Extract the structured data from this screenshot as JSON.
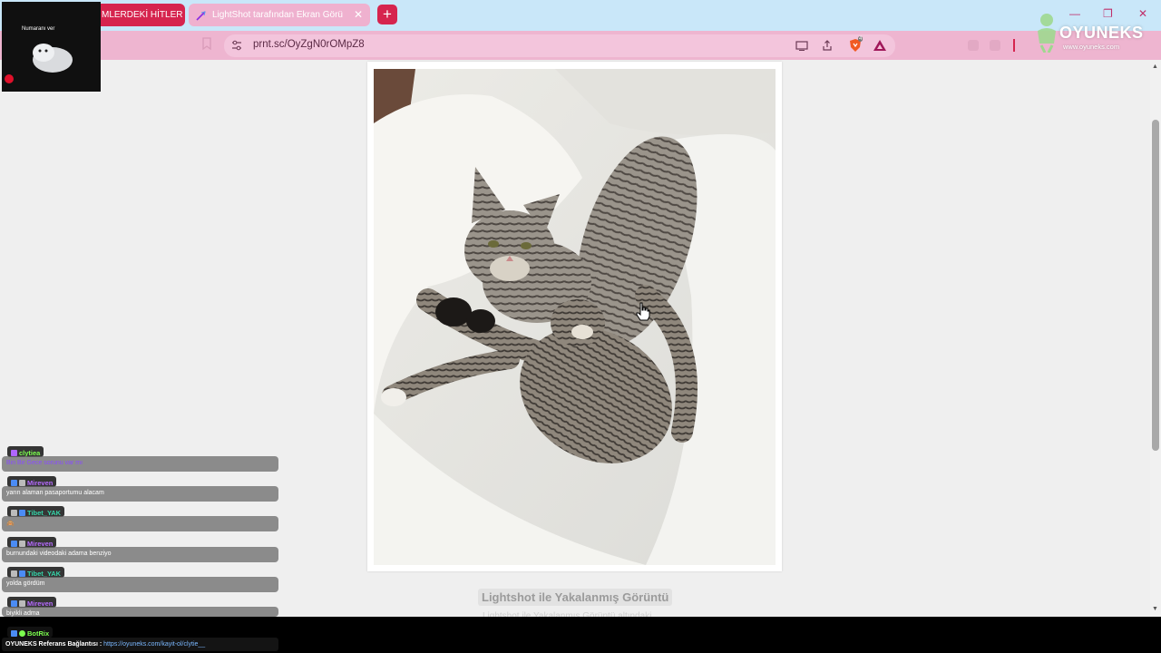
{
  "browser": {
    "tabs": [
      {
        "label": "MLERDEKİ HİTLER"
      },
      {
        "label": "LightShot tarafından Ekran Görü"
      }
    ],
    "new_tab_label": "+",
    "window_controls": {
      "minimize": "—",
      "restore": "❐",
      "close": "✕"
    },
    "url": "prnt.sc/OyZgN0rOMpZ8",
    "brave_shield_count": "4"
  },
  "page": {
    "caption": "Lightshot ile Yakalanmış Görüntü",
    "subcaption": "Lightshot ile Yakalanmış Görüntü altındaki"
  },
  "overlay": {
    "webcam_label": "Numaranı ver",
    "watermark": {
      "title": "OYUNEKS",
      "subtitle": "www.oyuneks.com"
    },
    "chat": [
      {
        "user": "clytiea",
        "text": "Bin Bir Gece sorunu var mı",
        "color": "#7cff4f"
      },
      {
        "user": "Mireven",
        "text": "yarın alaman pasaportumu alacam",
        "color": "#b66bff"
      },
      {
        "user": "Tibet_YAK",
        "text": "🙈",
        "color": "#35d3a8"
      },
      {
        "user": "Mireven",
        "text": "burnundaki videodaki adama benziyo",
        "color": "#b66bff"
      },
      {
        "user": "Tibet_YAK",
        "text": "yolda gördüm",
        "color": "#35d3a8"
      },
      {
        "user": "Mireven",
        "text": "biyikli adma",
        "color": "#b66bff"
      },
      {
        "user": "BotRix",
        "text": "",
        "color": "#7cff4f"
      }
    ],
    "referral": {
      "prefix": "OYUNEKS Referans Bağlantısı : ",
      "link": "https://oyuneks.com/kayit-ol/clytie__"
    }
  },
  "colors": {
    "tabstrip": "#c9e7f9",
    "toolbar": "#eeb5d0",
    "accent": "#d6244e",
    "page_bg": "#efefef"
  }
}
